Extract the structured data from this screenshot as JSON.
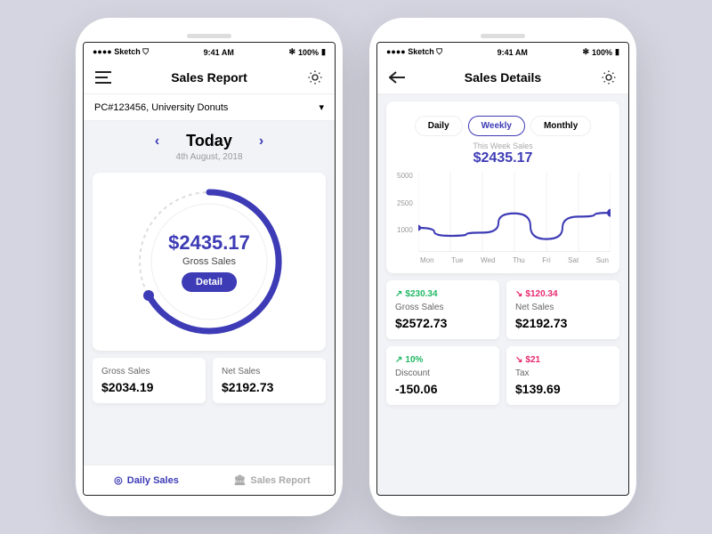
{
  "status": {
    "carrier": "Sketch",
    "time": "9:41 AM",
    "battery": "100%"
  },
  "p1": {
    "title": "Sales Report",
    "location": "PC#123456, University Donuts",
    "date": {
      "label": "Today",
      "sub": "4th August, 2018"
    },
    "gauge": {
      "amount": "$2435.17",
      "label": "Gross Sales",
      "detail": "Detail"
    },
    "cards": [
      {
        "label": "Gross Sales",
        "value": "$2034.19"
      },
      {
        "label": "Net Sales",
        "value": "$2192.73"
      }
    ],
    "tabs": [
      {
        "label": "Daily Sales"
      },
      {
        "label": "Sales Report"
      }
    ]
  },
  "p2": {
    "title": "Sales Details",
    "segments": [
      "Daily",
      "Weekly",
      "Monthly"
    ],
    "chart": {
      "title": "This Week Sales",
      "amount": "$2435.17"
    },
    "cards": [
      {
        "chg": "$230.34",
        "dir": "up",
        "label": "Gross Sales",
        "value": "$2572.73"
      },
      {
        "chg": "$120.34",
        "dir": "down",
        "label": "Net Sales",
        "value": "$2192.73"
      },
      {
        "chg": "10%",
        "dir": "up",
        "label": "Discount",
        "value": "-150.06"
      },
      {
        "chg": "$21",
        "dir": "down",
        "label": "Tax",
        "value": "$139.69"
      }
    ]
  },
  "chart_data": {
    "type": "line",
    "title": "This Week Sales",
    "categories": [
      "Mon",
      "Tue",
      "Wed",
      "Thu",
      "Fri",
      "Sat",
      "Sun"
    ],
    "values": [
      1500,
      1000,
      1200,
      2400,
      800,
      2200,
      2435
    ],
    "ylabel": "",
    "ylim": [
      0,
      5000
    ],
    "yticks": [
      1000,
      2500,
      5000
    ]
  }
}
